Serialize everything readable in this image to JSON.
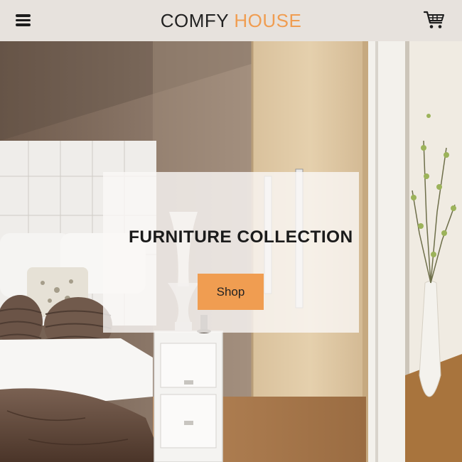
{
  "navbar": {
    "brand_main": "COMFY",
    "brand_accent": "HOUSE",
    "menu_icon": "hamburger-menu-icon",
    "cart_icon": "shopping-cart-icon"
  },
  "hero": {
    "title": "FURNITURE COLLECTION",
    "button_label": "Shop"
  },
  "colors": {
    "accent": "#f09d51",
    "navbar_bg": "#e7e2dd",
    "text": "#222222"
  }
}
